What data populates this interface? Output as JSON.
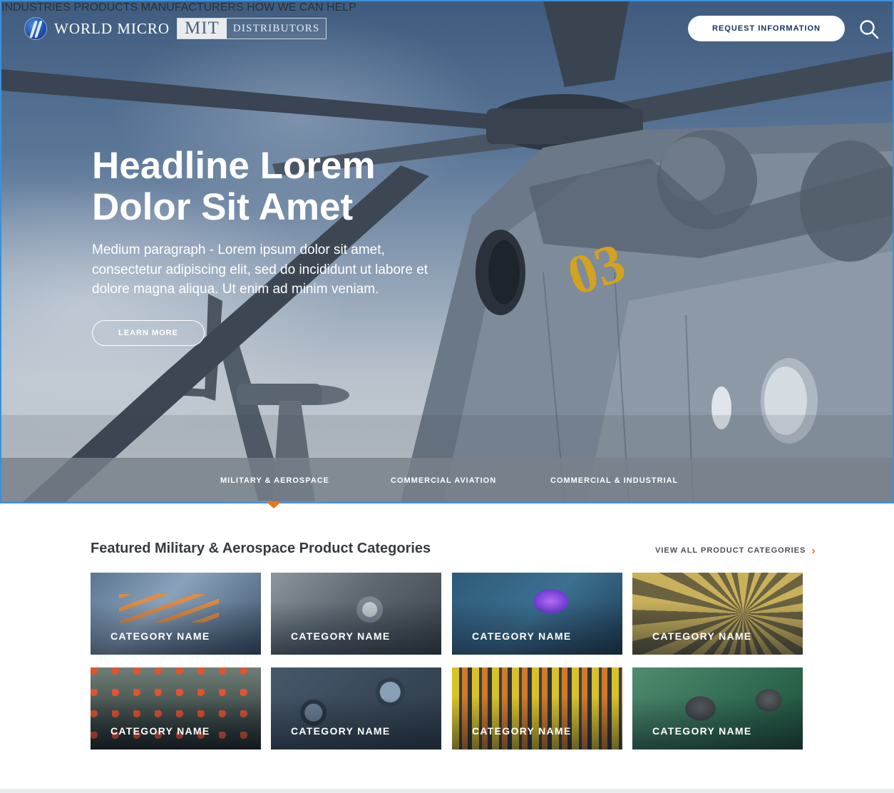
{
  "header": {
    "brand": "WORLD MICRO",
    "partner_primary": "MIT",
    "partner_secondary": "DISTRIBUTORS",
    "nav": [
      "INDUSTRIES",
      "PRODUCTS",
      "MANUFACTURERS",
      "HOW WE CAN HELP"
    ],
    "cta": "REQUEST INFORMATION"
  },
  "hero": {
    "headline_line1": "Headline Lorem",
    "headline_line2": "Dolor Sit Amet",
    "paragraph": "Medium paragraph - Lorem ipsum dolor sit amet, consectetur adipiscing elit, sed do incididunt ut labore et dolore magna aliqua. Ut enim ad minim veniam.",
    "button": "LEARN MORE",
    "tail_number": "03"
  },
  "industry_tabs": {
    "items": [
      "MILITARY & AEROSPACE",
      "COMMERCIAL AVIATION",
      "COMMERCIAL & INDUSTRIAL"
    ],
    "active_index": 0
  },
  "featured": {
    "title": "Featured Military & Aerospace Product Categories",
    "view_all": "VIEW ALL PRODUCT CATEGORIES",
    "cards": [
      {
        "label": "CATEGORY NAME"
      },
      {
        "label": "CATEGORY NAME"
      },
      {
        "label": "CATEGORY NAME"
      },
      {
        "label": "CATEGORY NAME"
      },
      {
        "label": "CATEGORY NAME"
      },
      {
        "label": "CATEGORY NAME"
      },
      {
        "label": "CATEGORY NAME"
      },
      {
        "label": "CATEGORY NAME"
      }
    ]
  },
  "colors": {
    "accent": "#e07a21",
    "cta_text": "#0f3566",
    "hero_border": "#3d8fd9"
  }
}
